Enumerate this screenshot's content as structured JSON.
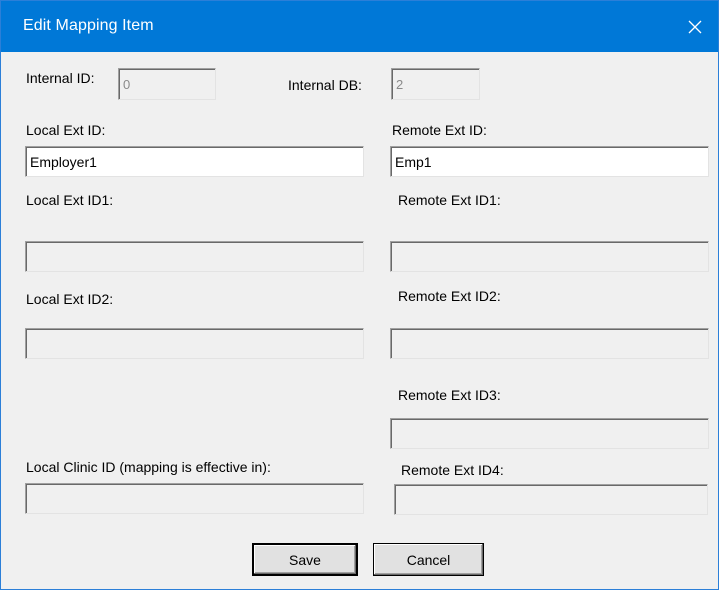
{
  "window": {
    "title": "Edit Mapping Item",
    "close_icon": "close-icon"
  },
  "internal": {
    "id_label": "Internal ID:",
    "id_value": "0",
    "db_label": "Internal DB:",
    "db_value": "2"
  },
  "local": {
    "ext_id_label": "Local Ext ID:",
    "ext_id_value": "Employer1",
    "ext_id1_label": "Local Ext ID1:",
    "ext_id1_value": "",
    "ext_id2_label": "Local Ext ID2:",
    "ext_id2_value": "",
    "clinic_id_label": "Local Clinic ID (mapping is effective in):",
    "clinic_id_value": ""
  },
  "remote": {
    "ext_id_label": "Remote Ext ID:",
    "ext_id_value": "Emp1",
    "ext_id1_label": "Remote Ext ID1:",
    "ext_id1_value": "",
    "ext_id2_label": "Remote Ext ID2:",
    "ext_id2_value": "",
    "ext_id3_label": "Remote Ext ID3:",
    "ext_id3_value": "",
    "ext_id4_label": "Remote Ext ID4:",
    "ext_id4_value": ""
  },
  "buttons": {
    "save": "Save",
    "cancel": "Cancel"
  },
  "colors": {
    "titlebar": "#0078d7",
    "dialog_bg": "#f0f0f0"
  }
}
